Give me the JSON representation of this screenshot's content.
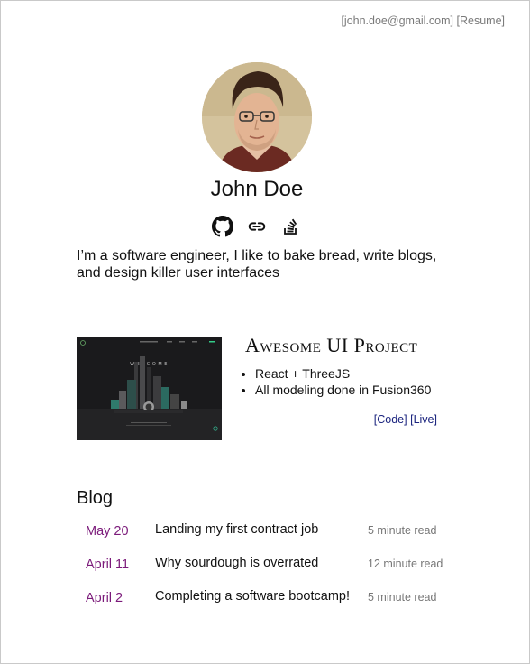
{
  "header": {
    "email_link": "[john.doe@gmail.com]",
    "resume_link": "[Resume]"
  },
  "profile": {
    "name": "John Doe",
    "bio": "I’m a software engineer, I like to bake bread, write blogs, and design killer user interfaces",
    "social_icons": [
      "github-icon",
      "link-icon",
      "stackoverflow-icon"
    ]
  },
  "project": {
    "title": "Awesome UI Project",
    "bullets": [
      "React + ThreeJS",
      "All modeling done in Fusion360"
    ],
    "code_link": "[Code]",
    "live_link": "[Live]",
    "preview": {
      "welcome_text": "W E L C O M E"
    }
  },
  "blog": {
    "heading": "Blog",
    "posts": [
      {
        "date": "May 20",
        "title": "Landing my first contract job",
        "read_time": "5 minute read"
      },
      {
        "date": "April 11",
        "title": "Why sourdough is overrated",
        "read_time": "12 minute read"
      },
      {
        "date": "April 2",
        "title": "Completing a software bootcamp!",
        "read_time": "5 minute read"
      }
    ]
  },
  "colors": {
    "date": "#7b1a7a",
    "link": "#1a237e",
    "muted": "#7a7a7a"
  }
}
